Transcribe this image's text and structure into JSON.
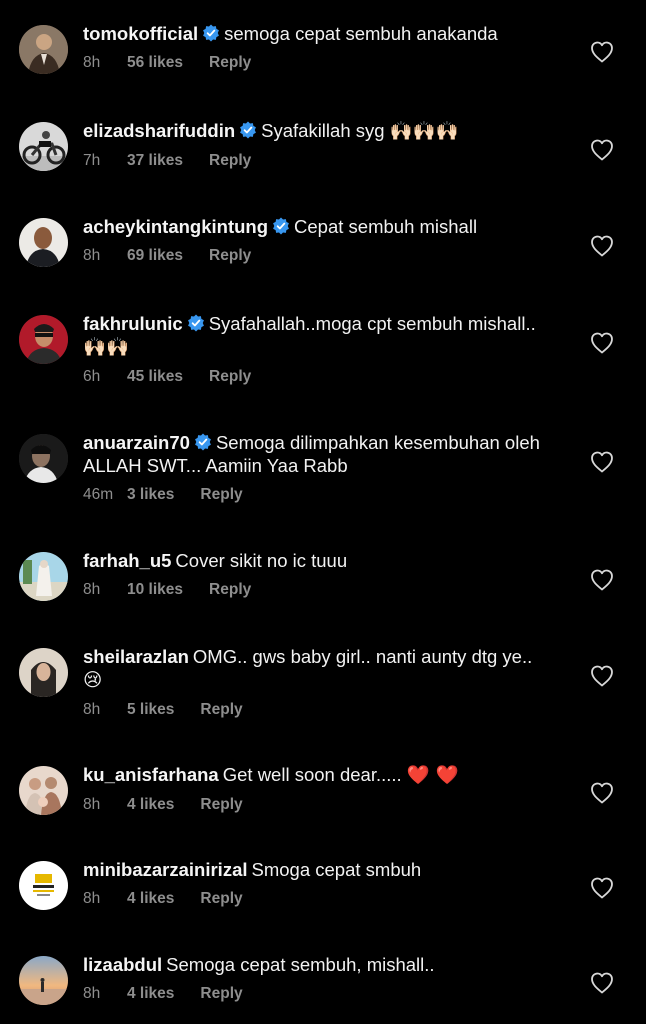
{
  "colors": {
    "background": "#000000",
    "text": "#f5f5f5",
    "meta": "#8e8e8e",
    "verified": "#3897f0"
  },
  "comments": [
    {
      "username": "tomokofficial",
      "verified": true,
      "text": "semoga cepat sembuh anakanda",
      "emoji": "",
      "time": "8h",
      "likes": "56 likes",
      "reply": "Reply",
      "avatar": "person-suit"
    },
    {
      "username": "elizadsharifuddin",
      "verified": true,
      "text": "Syafakillah syg",
      "emoji": "🙌🏻🙌🏻🙌🏻",
      "time": "7h",
      "likes": "37 likes",
      "reply": "Reply",
      "avatar": "motorcycle"
    },
    {
      "username": "acheykintangkintung",
      "verified": true,
      "text": "Cepat sembuh mishall",
      "emoji": "",
      "time": "8h",
      "likes": "69 likes",
      "reply": "Reply",
      "avatar": "person-portrait"
    },
    {
      "username": "fakhrulunic",
      "verified": true,
      "text": "Syafahallah..moga cpt sembuh mishall..",
      "emoji": "🙌🏻🙌🏻",
      "time": "6h",
      "likes": "45 likes",
      "reply": "Reply",
      "avatar": "person-red"
    },
    {
      "username": "anuarzain70",
      "verified": true,
      "text": "Semoga dilimpahkan kesembuhan oleh ALLAH SWT... Aamiin Yaa Rabb",
      "emoji": "",
      "time": "46m",
      "likes": "3 likes",
      "reply": "Reply",
      "avatar": "person-dark"
    },
    {
      "username": "farhah_u5",
      "verified": false,
      "text": "Cover sikit no ic tuuu",
      "emoji": "",
      "time": "8h",
      "likes": "10 likes",
      "reply": "Reply",
      "avatar": "person-outdoor"
    },
    {
      "username": "sheilarazlan",
      "verified": false,
      "text": "OMG.. gws baby girl.. nanti aunty dtg ye..",
      "emoji": "😢",
      "time": "8h",
      "likes": "5 likes",
      "reply": "Reply",
      "avatar": "person-hijab"
    },
    {
      "username": "ku_anisfarhana",
      "verified": false,
      "text": "Get well soon dear.....",
      "emoji": "❤️ ❤️",
      "time": "8h",
      "likes": "4 likes",
      "reply": "Reply",
      "avatar": "group-photo"
    },
    {
      "username": "minibazarzainirizal",
      "verified": false,
      "text": "Smoga cepat smbuh",
      "emoji": "",
      "time": "8h",
      "likes": "4 likes",
      "reply": "Reply",
      "avatar": "shop-logo"
    },
    {
      "username": "lizaabdul",
      "verified": false,
      "text": "Semoga cepat sembuh, mishall..",
      "emoji": "",
      "time": "8h",
      "likes": "4 likes",
      "reply": "Reply",
      "avatar": "sunset"
    }
  ]
}
